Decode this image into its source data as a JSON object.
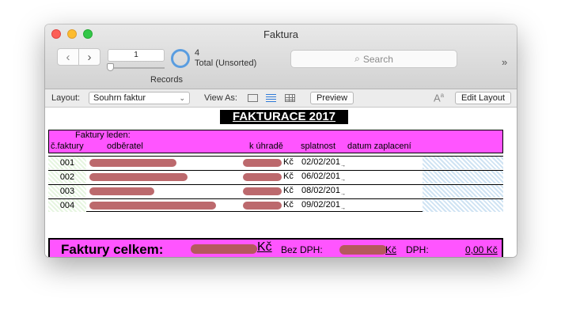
{
  "window": {
    "title": "Faktura"
  },
  "toolbar": {
    "back_icon": "chevron-left-icon",
    "forward_icon": "chevron-right-icon",
    "record_number": "1",
    "records_label": "Records",
    "total_count": "4",
    "total_label": "Total (Unsorted)",
    "search_placeholder": "Search",
    "more_label": "»"
  },
  "layout_bar": {
    "layout_label": "Layout:",
    "layout_value": "Souhrn faktur",
    "view_as_label": "View As:",
    "preview_label": "Preview",
    "font_icon_label": "Aa",
    "edit_layout_label": "Edit Layout"
  },
  "report": {
    "title": "FAKTURACE 2017",
    "header": {
      "group_label": "Faktury leden:",
      "col_number": "č.faktury",
      "col_customer": "odběratel",
      "col_amount": "k úhradě",
      "col_due": "splatnost",
      "col_paid": "datum zaplacení"
    },
    "rows": [
      {
        "number": "001",
        "currency": "Kč",
        "due": "02/02/201"
      },
      {
        "number": "002",
        "currency": "Kč",
        "due": "06/02/201"
      },
      {
        "number": "003",
        "currency": "Kč",
        "due": "08/02/201"
      },
      {
        "number": "004",
        "currency": "Kč",
        "due": "09/02/201"
      }
    ],
    "totals": {
      "label": "Faktury celkem:",
      "total_currency": "Kč",
      "bez_dph_label": "Bez DPH:",
      "bez_dph_currency": "Kč",
      "dph_label": "DPH:",
      "dph_value": "0,00 Kč"
    }
  },
  "colors": {
    "magenta": "#ff55ff",
    "redaction": "#b5595d",
    "accent": "#5a9de0"
  }
}
